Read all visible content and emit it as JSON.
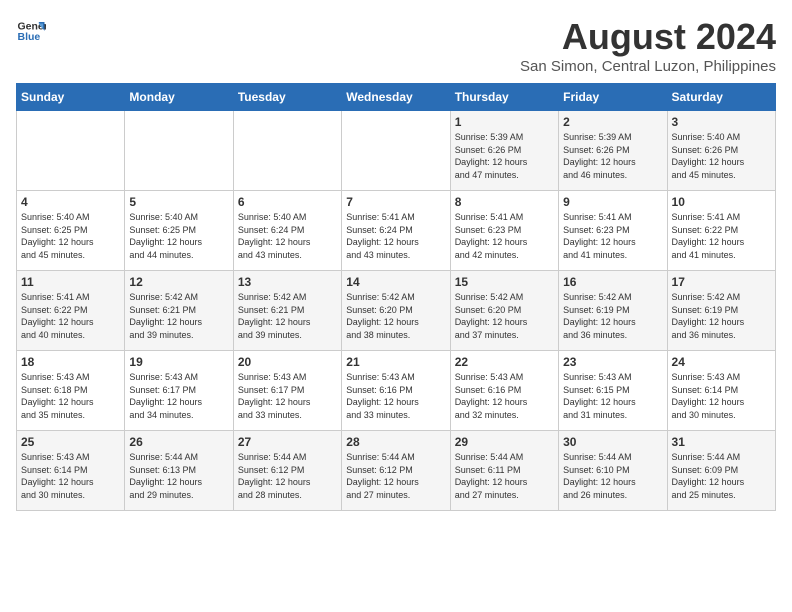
{
  "header": {
    "logo_general": "General",
    "logo_blue": "Blue",
    "month_year": "August 2024",
    "location": "San Simon, Central Luzon, Philippines"
  },
  "weekdays": [
    "Sunday",
    "Monday",
    "Tuesday",
    "Wednesday",
    "Thursday",
    "Friday",
    "Saturday"
  ],
  "weeks": [
    [
      {
        "day": "",
        "info": ""
      },
      {
        "day": "",
        "info": ""
      },
      {
        "day": "",
        "info": ""
      },
      {
        "day": "",
        "info": ""
      },
      {
        "day": "1",
        "info": "Sunrise: 5:39 AM\nSunset: 6:26 PM\nDaylight: 12 hours\nand 47 minutes."
      },
      {
        "day": "2",
        "info": "Sunrise: 5:39 AM\nSunset: 6:26 PM\nDaylight: 12 hours\nand 46 minutes."
      },
      {
        "day": "3",
        "info": "Sunrise: 5:40 AM\nSunset: 6:26 PM\nDaylight: 12 hours\nand 45 minutes."
      }
    ],
    [
      {
        "day": "4",
        "info": "Sunrise: 5:40 AM\nSunset: 6:25 PM\nDaylight: 12 hours\nand 45 minutes."
      },
      {
        "day": "5",
        "info": "Sunrise: 5:40 AM\nSunset: 6:25 PM\nDaylight: 12 hours\nand 44 minutes."
      },
      {
        "day": "6",
        "info": "Sunrise: 5:40 AM\nSunset: 6:24 PM\nDaylight: 12 hours\nand 43 minutes."
      },
      {
        "day": "7",
        "info": "Sunrise: 5:41 AM\nSunset: 6:24 PM\nDaylight: 12 hours\nand 43 minutes."
      },
      {
        "day": "8",
        "info": "Sunrise: 5:41 AM\nSunset: 6:23 PM\nDaylight: 12 hours\nand 42 minutes."
      },
      {
        "day": "9",
        "info": "Sunrise: 5:41 AM\nSunset: 6:23 PM\nDaylight: 12 hours\nand 41 minutes."
      },
      {
        "day": "10",
        "info": "Sunrise: 5:41 AM\nSunset: 6:22 PM\nDaylight: 12 hours\nand 41 minutes."
      }
    ],
    [
      {
        "day": "11",
        "info": "Sunrise: 5:41 AM\nSunset: 6:22 PM\nDaylight: 12 hours\nand 40 minutes."
      },
      {
        "day": "12",
        "info": "Sunrise: 5:42 AM\nSunset: 6:21 PM\nDaylight: 12 hours\nand 39 minutes."
      },
      {
        "day": "13",
        "info": "Sunrise: 5:42 AM\nSunset: 6:21 PM\nDaylight: 12 hours\nand 39 minutes."
      },
      {
        "day": "14",
        "info": "Sunrise: 5:42 AM\nSunset: 6:20 PM\nDaylight: 12 hours\nand 38 minutes."
      },
      {
        "day": "15",
        "info": "Sunrise: 5:42 AM\nSunset: 6:20 PM\nDaylight: 12 hours\nand 37 minutes."
      },
      {
        "day": "16",
        "info": "Sunrise: 5:42 AM\nSunset: 6:19 PM\nDaylight: 12 hours\nand 36 minutes."
      },
      {
        "day": "17",
        "info": "Sunrise: 5:42 AM\nSunset: 6:19 PM\nDaylight: 12 hours\nand 36 minutes."
      }
    ],
    [
      {
        "day": "18",
        "info": "Sunrise: 5:43 AM\nSunset: 6:18 PM\nDaylight: 12 hours\nand 35 minutes."
      },
      {
        "day": "19",
        "info": "Sunrise: 5:43 AM\nSunset: 6:17 PM\nDaylight: 12 hours\nand 34 minutes."
      },
      {
        "day": "20",
        "info": "Sunrise: 5:43 AM\nSunset: 6:17 PM\nDaylight: 12 hours\nand 33 minutes."
      },
      {
        "day": "21",
        "info": "Sunrise: 5:43 AM\nSunset: 6:16 PM\nDaylight: 12 hours\nand 33 minutes."
      },
      {
        "day": "22",
        "info": "Sunrise: 5:43 AM\nSunset: 6:16 PM\nDaylight: 12 hours\nand 32 minutes."
      },
      {
        "day": "23",
        "info": "Sunrise: 5:43 AM\nSunset: 6:15 PM\nDaylight: 12 hours\nand 31 minutes."
      },
      {
        "day": "24",
        "info": "Sunrise: 5:43 AM\nSunset: 6:14 PM\nDaylight: 12 hours\nand 30 minutes."
      }
    ],
    [
      {
        "day": "25",
        "info": "Sunrise: 5:43 AM\nSunset: 6:14 PM\nDaylight: 12 hours\nand 30 minutes."
      },
      {
        "day": "26",
        "info": "Sunrise: 5:44 AM\nSunset: 6:13 PM\nDaylight: 12 hours\nand 29 minutes."
      },
      {
        "day": "27",
        "info": "Sunrise: 5:44 AM\nSunset: 6:12 PM\nDaylight: 12 hours\nand 28 minutes."
      },
      {
        "day": "28",
        "info": "Sunrise: 5:44 AM\nSunset: 6:12 PM\nDaylight: 12 hours\nand 27 minutes."
      },
      {
        "day": "29",
        "info": "Sunrise: 5:44 AM\nSunset: 6:11 PM\nDaylight: 12 hours\nand 27 minutes."
      },
      {
        "day": "30",
        "info": "Sunrise: 5:44 AM\nSunset: 6:10 PM\nDaylight: 12 hours\nand 26 minutes."
      },
      {
        "day": "31",
        "info": "Sunrise: 5:44 AM\nSunset: 6:09 PM\nDaylight: 12 hours\nand 25 minutes."
      }
    ]
  ]
}
